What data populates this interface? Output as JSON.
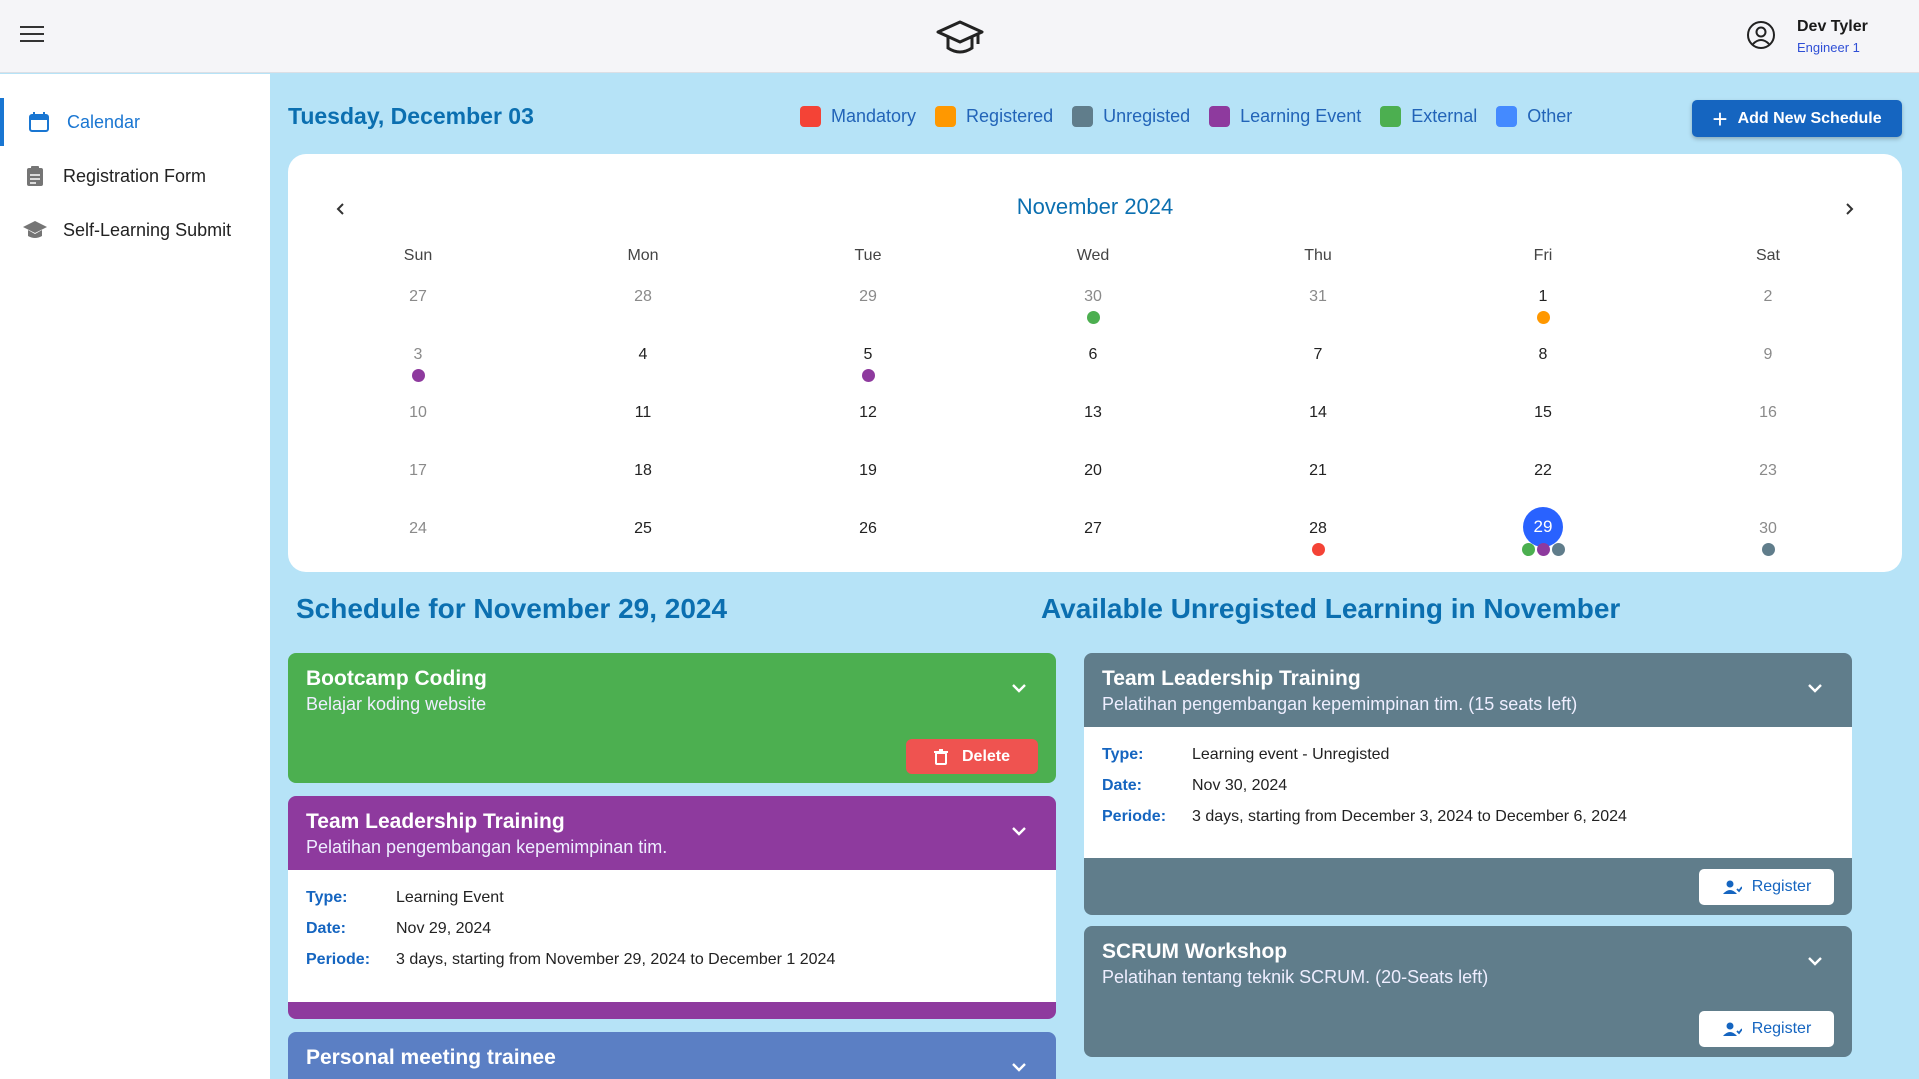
{
  "header": {
    "user_name": "Dev Tyler",
    "user_role": "Engineer 1"
  },
  "sidebar": {
    "items": [
      {
        "label": "Calendar",
        "icon": "calendar-icon",
        "active": true
      },
      {
        "label": "Registration Form",
        "icon": "clipboard-icon",
        "active": false
      },
      {
        "label": "Self-Learning Submit",
        "icon": "graduation-cap-icon",
        "active": false
      }
    ]
  },
  "main": {
    "date_title": "Tuesday, December 03",
    "add_button_label": "Add New Schedule",
    "legend": [
      {
        "label": "Mandatory",
        "color": "#f44336"
      },
      {
        "label": "Registered",
        "color": "#ff9800"
      },
      {
        "label": "Unregisted",
        "color": "#607d8b"
      },
      {
        "label": "Learning Event",
        "color": "#8e3a9e"
      },
      {
        "label": "External",
        "color": "#4caf50"
      },
      {
        "label": "Other",
        "color": "#448aff"
      }
    ]
  },
  "calendar": {
    "month_label": "November 2024",
    "weekdays": [
      "Sun",
      "Mon",
      "Tue",
      "Wed",
      "Thu",
      "Fri",
      "Sat"
    ],
    "weeks": [
      [
        {
          "d": "27",
          "m": true
        },
        {
          "d": "28",
          "m": true
        },
        {
          "d": "29",
          "m": true
        },
        {
          "d": "30",
          "m": true,
          "dots": [
            "#4caf50"
          ]
        },
        {
          "d": "31",
          "m": true
        },
        {
          "d": "1",
          "dots": [
            "#ff9800"
          ]
        },
        {
          "d": "2",
          "m": true
        }
      ],
      [
        {
          "d": "3",
          "m": true,
          "dots": [
            "#8e3a9e"
          ]
        },
        {
          "d": "4"
        },
        {
          "d": "5",
          "dots": [
            "#8e3a9e"
          ]
        },
        {
          "d": "6"
        },
        {
          "d": "7"
        },
        {
          "d": "8"
        },
        {
          "d": "9",
          "m": true
        }
      ],
      [
        {
          "d": "10",
          "m": true
        },
        {
          "d": "11"
        },
        {
          "d": "12"
        },
        {
          "d": "13"
        },
        {
          "d": "14"
        },
        {
          "d": "15"
        },
        {
          "d": "16",
          "m": true
        }
      ],
      [
        {
          "d": "17",
          "m": true
        },
        {
          "d": "18"
        },
        {
          "d": "19"
        },
        {
          "d": "20"
        },
        {
          "d": "21"
        },
        {
          "d": "22"
        },
        {
          "d": "23",
          "m": true
        }
      ],
      [
        {
          "d": "24",
          "m": true
        },
        {
          "d": "25"
        },
        {
          "d": "26"
        },
        {
          "d": "27"
        },
        {
          "d": "28",
          "dots": [
            "#f44336"
          ]
        },
        {
          "d": "29",
          "selected": true,
          "dots": [
            "#4caf50",
            "#8e3a9e",
            "#607d8b"
          ]
        },
        {
          "d": "30",
          "m": true,
          "dots": [
            "#607d8b"
          ]
        }
      ]
    ]
  },
  "schedule": {
    "title": "Schedule for November 29, 2024",
    "cards": [
      {
        "title": "Bootcamp Coding",
        "subtitle": "Belajar koding website",
        "color": "#4caf50",
        "delete_label": "Delete"
      },
      {
        "title": "Team Leadership Training",
        "subtitle": "Pelatihan pengembangan kepemimpinan tim.",
        "color": "#8e3a9e",
        "details": [
          {
            "key": "Type:",
            "value": "Learning Event"
          },
          {
            "key": "Date:",
            "value": "Nov 29, 2024"
          },
          {
            "key": "Periode:",
            "value": "3 days, starting from November 29, 2024 to December 1 2024"
          }
        ]
      },
      {
        "title": "Personal meeting trainee",
        "color": "#5b7fc4"
      }
    ]
  },
  "available": {
    "title": "Available Unregisted Learning in November",
    "cards": [
      {
        "title": "Team Leadership Training",
        "subtitle": "Pelatihan pengembangan kepemimpinan tim. (15 seats left)",
        "color": "#607d8b",
        "details": [
          {
            "key": "Type:",
            "value": "Learning event - Unregisted"
          },
          {
            "key": "Date:",
            "value": "Nov 30, 2024"
          },
          {
            "key": "Periode:",
            "value": "3 days, starting from December 3, 2024 to December 6, 2024"
          }
        ],
        "register_label": "Register"
      },
      {
        "title": "SCRUM Workshop",
        "subtitle": "Pelatihan tentang teknik SCRUM. (20-Seats left)",
        "color": "#607d8b",
        "register_label": "Register"
      }
    ]
  }
}
